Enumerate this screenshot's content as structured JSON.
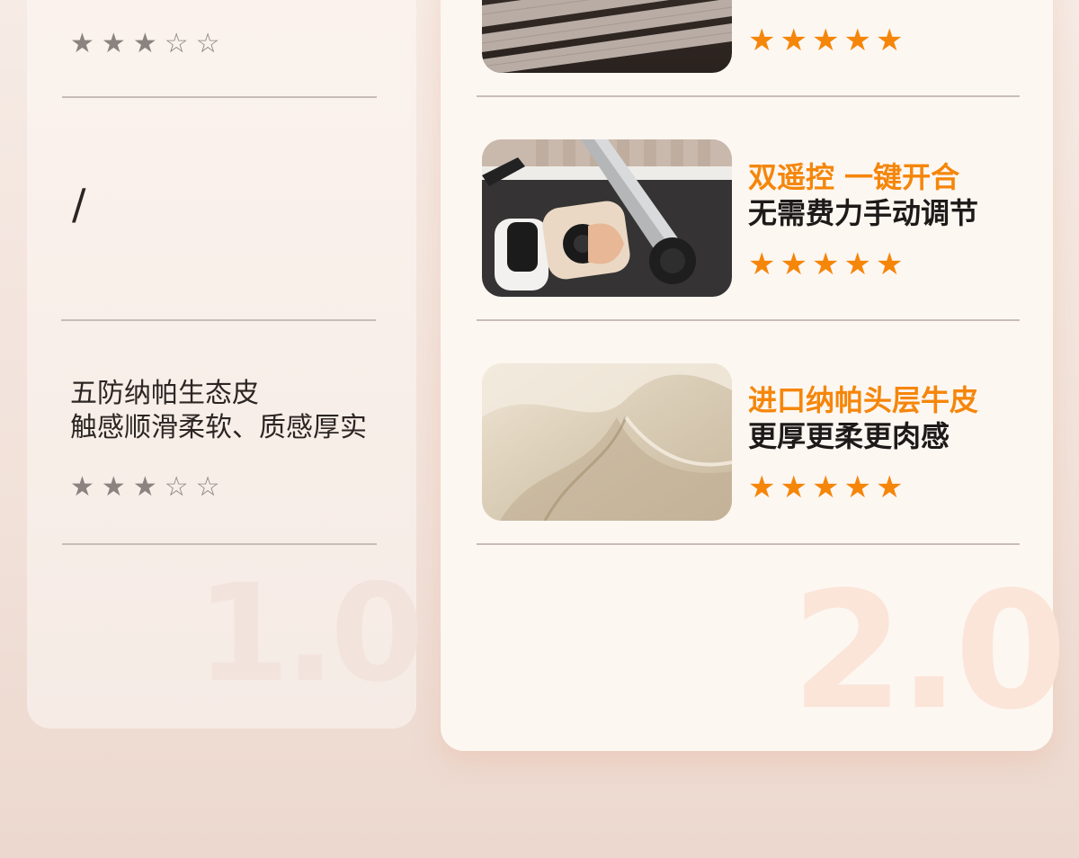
{
  "left": {
    "rows": [
      {
        "rating": 3,
        "max": 5
      },
      {
        "text": "/"
      },
      {
        "lines": [
          "五防纳帕生态皮",
          "触感顺滑柔软、质感厚实"
        ],
        "rating": 3,
        "max": 5
      }
    ],
    "version": "1.0"
  },
  "right": {
    "rows": [
      {
        "image": "slatted-bed-frame-photo",
        "title_orange": "",
        "title_dark": "",
        "rating": 5,
        "max": 5
      },
      {
        "image": "remote-control-mechanism-photo",
        "title_orange": "双遥控 一键开合",
        "title_dark": "无需费力手动调节",
        "rating": 5,
        "max": 5
      },
      {
        "image": "leather-texture-photo",
        "title_orange": "进口纳帕头层牛皮",
        "title_dark": "更厚更柔更肉感",
        "rating": 5,
        "max": 5
      }
    ],
    "version": "2.0"
  },
  "colors": {
    "accent": "#f5860a",
    "star_grey": "#8b8380"
  },
  "icons": {
    "filled_star": "★",
    "empty_star": "☆"
  }
}
